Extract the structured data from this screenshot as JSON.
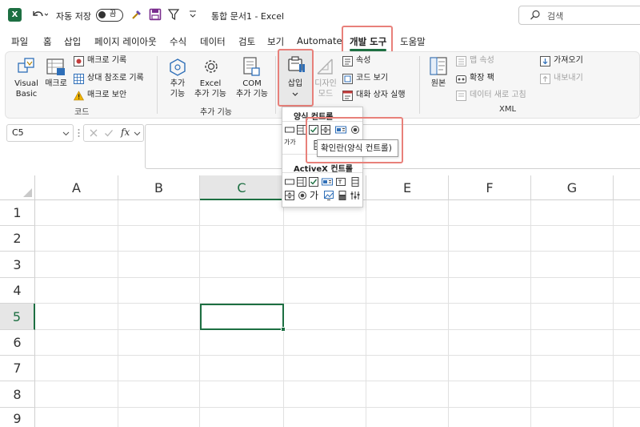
{
  "titlebar": {
    "autosave_label": "자동 저장",
    "autosave_state": "끔",
    "document_title": "통합 문서1  -  Excel",
    "search_placeholder": "검색"
  },
  "menu": {
    "tabs": [
      "파일",
      "홈",
      "삽입",
      "페이지 레이아웃",
      "수식",
      "데이터",
      "검토",
      "보기",
      "Automate",
      "개발 도구",
      "도움말"
    ],
    "active_tab": "개발 도구"
  },
  "ribbon": {
    "code": {
      "visual_basic": [
        "Visual",
        "Basic"
      ],
      "macro": "매크로",
      "record_macro": "매크로 기록",
      "relative_refs": "상대 참조로 기록",
      "macro_security": "매크로 보안",
      "group_label": "코드"
    },
    "addins": {
      "addins": [
        "추가",
        "기능"
      ],
      "excel_addins": [
        "Excel",
        "추가 기능"
      ],
      "com_addins": [
        "COM",
        "추가 기능"
      ],
      "group_label": "추가 기능"
    },
    "controls": {
      "insert": "삽입",
      "design_mode": [
        "디자인",
        "모드"
      ],
      "properties": "속성",
      "view_code": "코드 보기",
      "run_dialog": "대화 상자 실행"
    },
    "xml": {
      "source": "원본",
      "map_properties": "맵 속성",
      "expansion_packs": "확장 팩",
      "refresh_data": "데이터 새로 고침",
      "import": "가져오기",
      "export": "내보내기",
      "group_label": "XML"
    }
  },
  "formula_bar": {
    "name_box": "C5",
    "fx": "fx",
    "value": ""
  },
  "grid": {
    "columns": [
      "A",
      "B",
      "C",
      "D",
      "E",
      "F",
      "G"
    ],
    "rows": [
      "1",
      "2",
      "3",
      "4",
      "5",
      "6",
      "7",
      "8",
      "9"
    ],
    "selected_column": "C",
    "selected_row": "5",
    "active_cell": "C5"
  },
  "dropdown": {
    "form_controls_title": "양식 컨트롤",
    "activex_controls_title": "ActiveX 컨트롤",
    "form_label_glyph": "가가",
    "activex_label_glyph": "가",
    "tooltip": "확인란(양식 컨트롤)"
  },
  "colors": {
    "excel_green": "#1d6f42",
    "highlight_red": "#e8807a",
    "accent_blue": "#2f6fb8"
  }
}
